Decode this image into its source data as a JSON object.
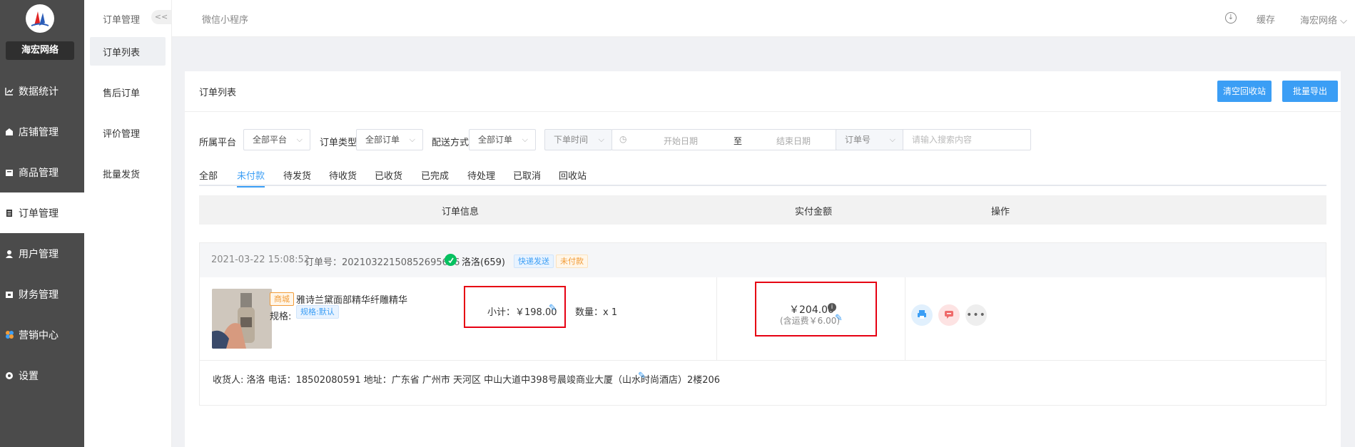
{
  "brand": {
    "name": "海宏网络"
  },
  "nav": [
    {
      "label": "数据统计",
      "icon": "chart-icon"
    },
    {
      "label": "店铺管理",
      "icon": "store-icon"
    },
    {
      "label": "商品管理",
      "icon": "goods-icon"
    },
    {
      "label": "订单管理",
      "icon": "order-icon"
    },
    {
      "label": "用户管理",
      "icon": "user-icon"
    },
    {
      "label": "财务管理",
      "icon": "finance-icon"
    },
    {
      "label": "营销中心",
      "icon": "marketing-icon"
    },
    {
      "label": "设置",
      "icon": "settings-icon"
    }
  ],
  "subnav": {
    "title": "订单管理",
    "collapse": "<<",
    "items": [
      "订单列表",
      "售后订单",
      "评价管理",
      "批量发货"
    ]
  },
  "topbar": {
    "platform": "微信小程序",
    "cache": "缓存",
    "user": "海宏网络"
  },
  "card": {
    "title": "订单列表",
    "btn_clear": "清空回收站",
    "btn_export": "批量导出"
  },
  "filters": {
    "platform_label": "所属平台",
    "platform_value": "全部平台",
    "type_label": "订单类型",
    "type_value": "全部订单",
    "delivery_label": "配送方式",
    "delivery_value": "全部订单",
    "time_select": "下单时间",
    "start_placeholder": "开始日期",
    "range_sep": "至",
    "end_placeholder": "结束日期",
    "orderno_select": "订单号",
    "search_placeholder": "请输入搜索内容"
  },
  "tabs": [
    "全部",
    "未付款",
    "待发货",
    "待收货",
    "已收货",
    "已完成",
    "待处理",
    "已取消",
    "回收站"
  ],
  "table_head": {
    "info": "订单信息",
    "paid": "实付金额",
    "ops": "操作"
  },
  "order": {
    "time": "2021-03-22 15:08:52",
    "order_no": "订单号：20210322150852695606",
    "buyer": "洛洛(659)",
    "tag_express": "快递发送",
    "tag_status": "未付款",
    "shop_tag": "商城",
    "product_name": "雅诗兰黛面部精华纤雕精华",
    "spec_label": "规格:",
    "spec_value": "规格:默认",
    "subtotal": "小计：￥198.00",
    "qty": "数量：x 1",
    "paid": "￥204.00",
    "shipping": "(含运费￥6.00)",
    "address": "收货人: 洛洛 电话：18502080591 地址：广东省 广州市 天河区 中山大道中398号晨竣商业大厦（山水时尚酒店）2楼206"
  },
  "colors": {
    "sidebar": "#4b4b4b",
    "accent": "#3b9ef5",
    "highlight": "#e60012",
    "warn": "#f29c38",
    "wechat": "#07c160"
  }
}
